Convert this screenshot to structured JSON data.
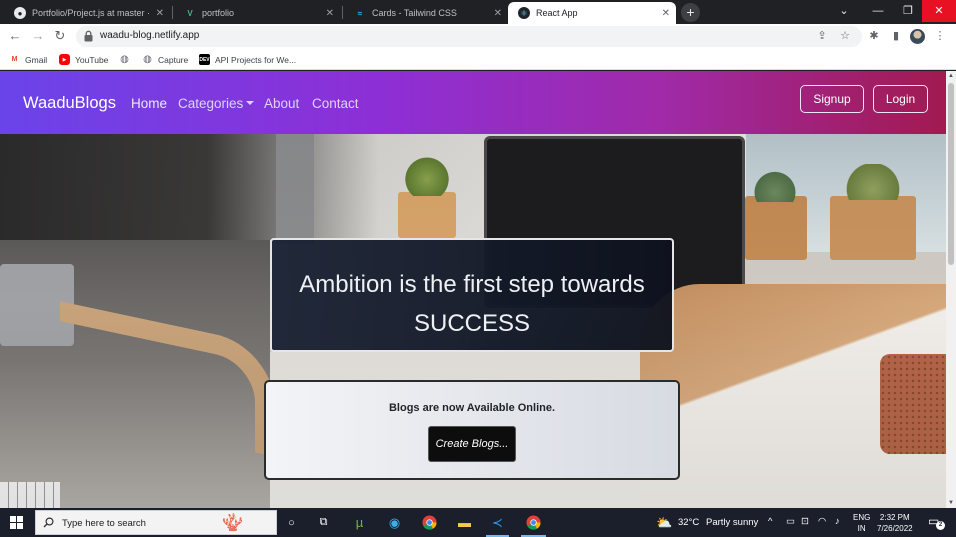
{
  "browser": {
    "tabs": [
      {
        "title": "Portfolio/Project.js at master · Sh",
        "icon": "github-icon",
        "active": false
      },
      {
        "title": "portfolio",
        "icon": "vue-icon",
        "active": false
      },
      {
        "title": "Cards - Tailwind CSS",
        "icon": "tailwind-icon",
        "active": false
      },
      {
        "title": "React App",
        "icon": "react-icon",
        "active": true
      }
    ],
    "url": "waadu-blog.netlify.app",
    "bookmarks": [
      {
        "label": "Gmail",
        "icon": "gmail-icon"
      },
      {
        "label": "YouTube",
        "icon": "youtube-icon"
      },
      {
        "label": "",
        "icon": "globe-icon"
      },
      {
        "label": "Capture",
        "icon": "globe-icon"
      },
      {
        "label": "API Projects for We...",
        "icon": "dev-icon"
      }
    ]
  },
  "site": {
    "brand": "WaaduBlogs",
    "nav": {
      "home": "Home",
      "categories": "Categories",
      "about": "About",
      "contact": "Contact",
      "signup": "Signup",
      "login": "Login"
    },
    "hero": {
      "quote_line1": "Ambition is the first step towards",
      "quote_line2": "SUCCESS",
      "cta_text": "Blogs are now Available Online.",
      "cta_button": "Create Blogs..."
    },
    "colors": {
      "navbar_start": "#6a44e9",
      "navbar_end": "#a11a4f",
      "quote_card": "#141c2e",
      "cta_button": "#0d0d0d"
    }
  },
  "taskbar": {
    "search_placeholder": "Type here to search",
    "weather_temp": "32°C",
    "weather_condition": "Partly sunny",
    "language_line1": "ENG",
    "language_line2": "IN",
    "time": "2:32 PM",
    "date": "7/26/2022",
    "notification_count": "2"
  }
}
